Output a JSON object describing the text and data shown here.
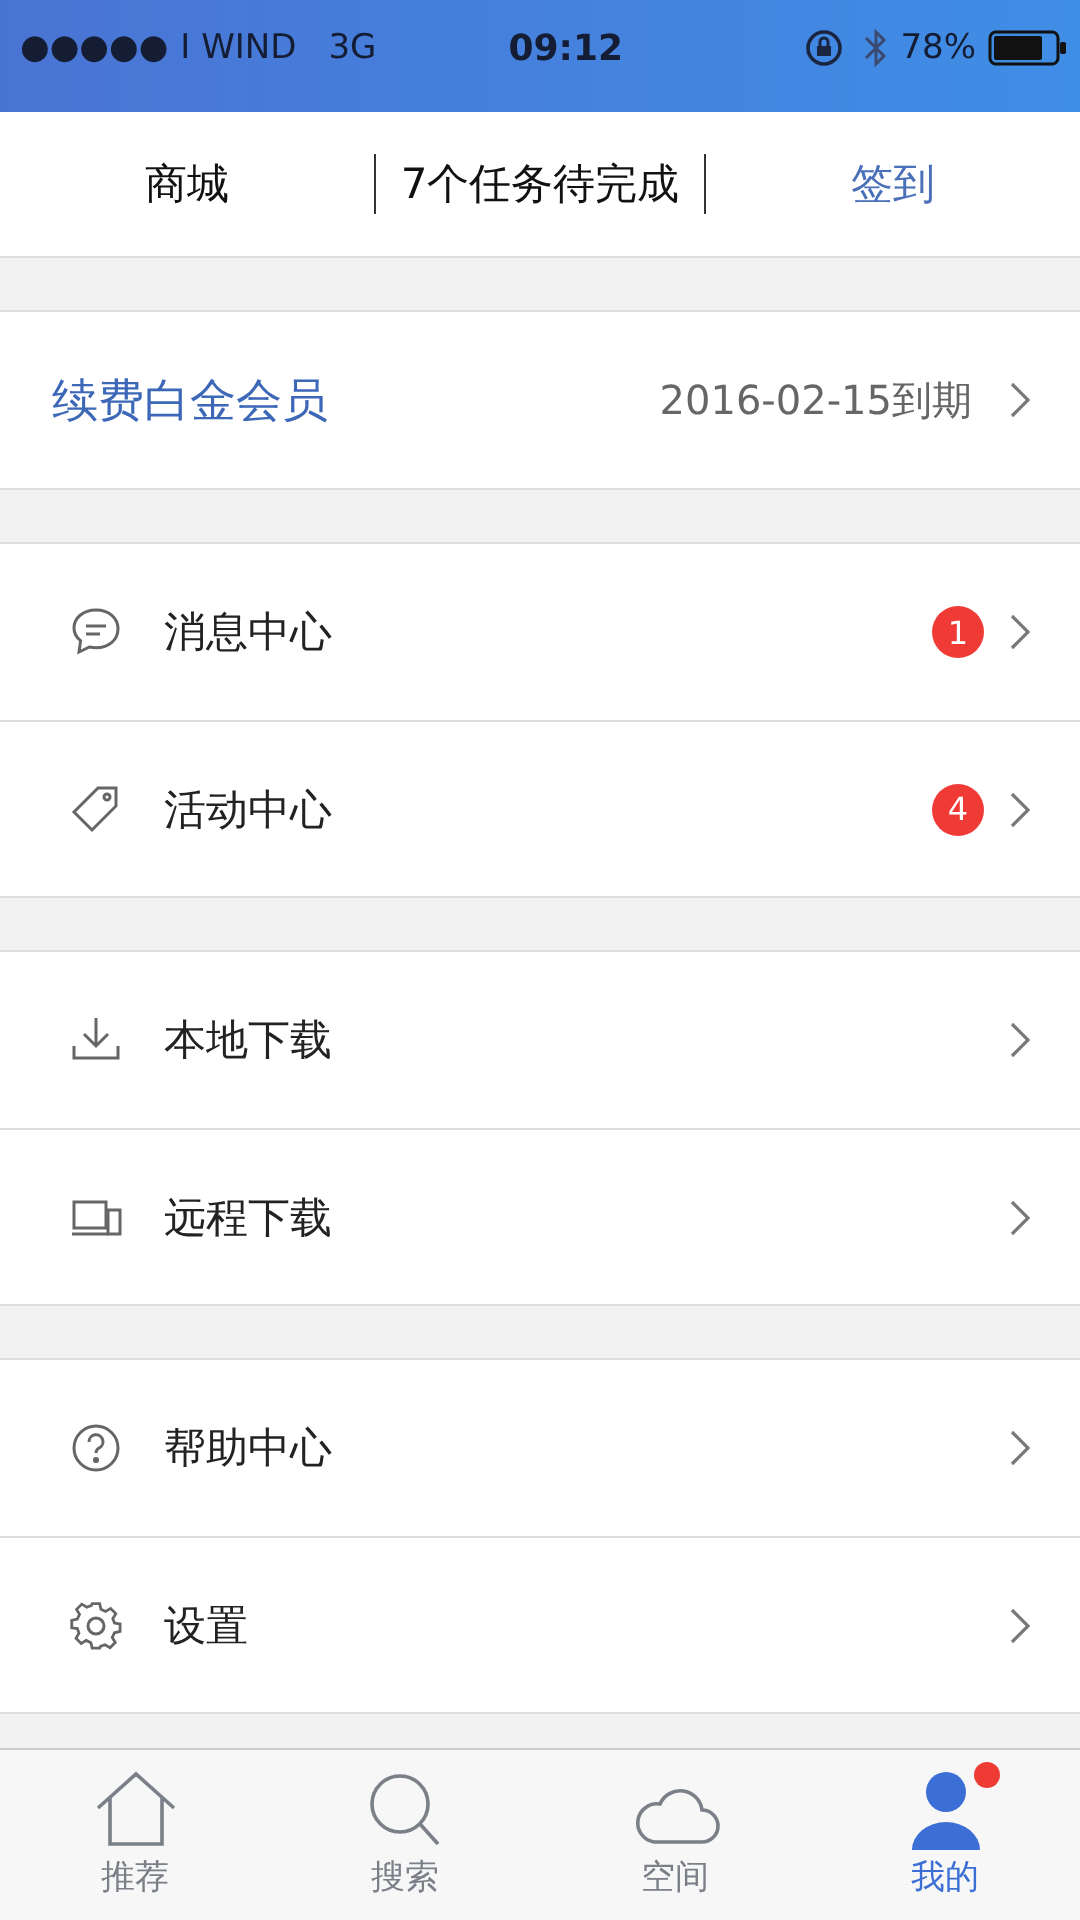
{
  "status_bar": {
    "signal": "●●●●●",
    "carrier": "I WIND",
    "network": "3G",
    "time": "09:12",
    "battery": "78%"
  },
  "top_bar": {
    "left": "商城",
    "center": "7个任务待完成",
    "right": "签到"
  },
  "membership": {
    "label": "续费白金会员",
    "expiry": "2016-02-15到期"
  },
  "sections": [
    {
      "rows": [
        {
          "label": "消息中心",
          "badge": "1"
        },
        {
          "label": "活动中心",
          "badge": "4"
        }
      ]
    },
    {
      "rows": [
        {
          "label": "本地下载"
        },
        {
          "label": "远程下载"
        }
      ]
    },
    {
      "rows": [
        {
          "label": "帮助中心"
        },
        {
          "label": "设置"
        }
      ]
    }
  ],
  "tab_bar": [
    {
      "label": "推荐",
      "selected": false,
      "dot": false
    },
    {
      "label": "搜索",
      "selected": false,
      "dot": false
    },
    {
      "label": "空间",
      "selected": false,
      "dot": false
    },
    {
      "label": "我的",
      "selected": true,
      "dot": true
    }
  ]
}
